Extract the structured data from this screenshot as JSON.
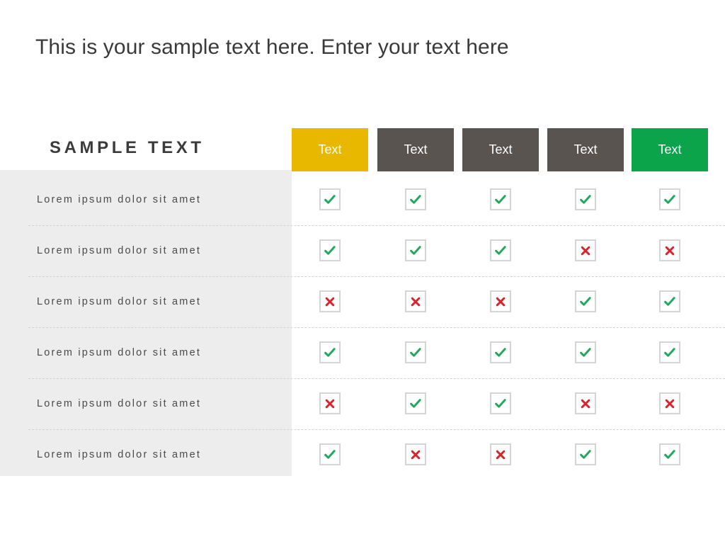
{
  "title": "This is your sample text here. Enter your text here",
  "table": {
    "row_header_title": "SAMPLE TEXT",
    "columns": [
      {
        "label": "Text",
        "color": "#E8B800"
      },
      {
        "label": "Text",
        "color": "#5A5450"
      },
      {
        "label": "Text",
        "color": "#5A5450"
      },
      {
        "label": "Text",
        "color": "#5A5450"
      },
      {
        "label": "Text",
        "color": "#0CA44A"
      }
    ],
    "check_color": "#1FA85A",
    "cross_color": "#D8232A",
    "rows": [
      {
        "label": "Lorem ipsum dolor sit amet",
        "marks": [
          "check",
          "check",
          "check",
          "check",
          "check"
        ]
      },
      {
        "label": "Lorem ipsum dolor sit amet",
        "marks": [
          "check",
          "check",
          "check",
          "cross",
          "cross"
        ]
      },
      {
        "label": "Lorem ipsum dolor sit amet",
        "marks": [
          "cross",
          "cross",
          "cross",
          "check",
          "check"
        ]
      },
      {
        "label": "Lorem ipsum dolor sit amet",
        "marks": [
          "check",
          "check",
          "check",
          "check",
          "check"
        ]
      },
      {
        "label": "Lorem ipsum dolor sit amet",
        "marks": [
          "cross",
          "check",
          "check",
          "cross",
          "cross"
        ]
      },
      {
        "label": "Lorem ipsum dolor sit amet",
        "marks": [
          "check",
          "cross",
          "cross",
          "check",
          "check"
        ]
      }
    ]
  }
}
